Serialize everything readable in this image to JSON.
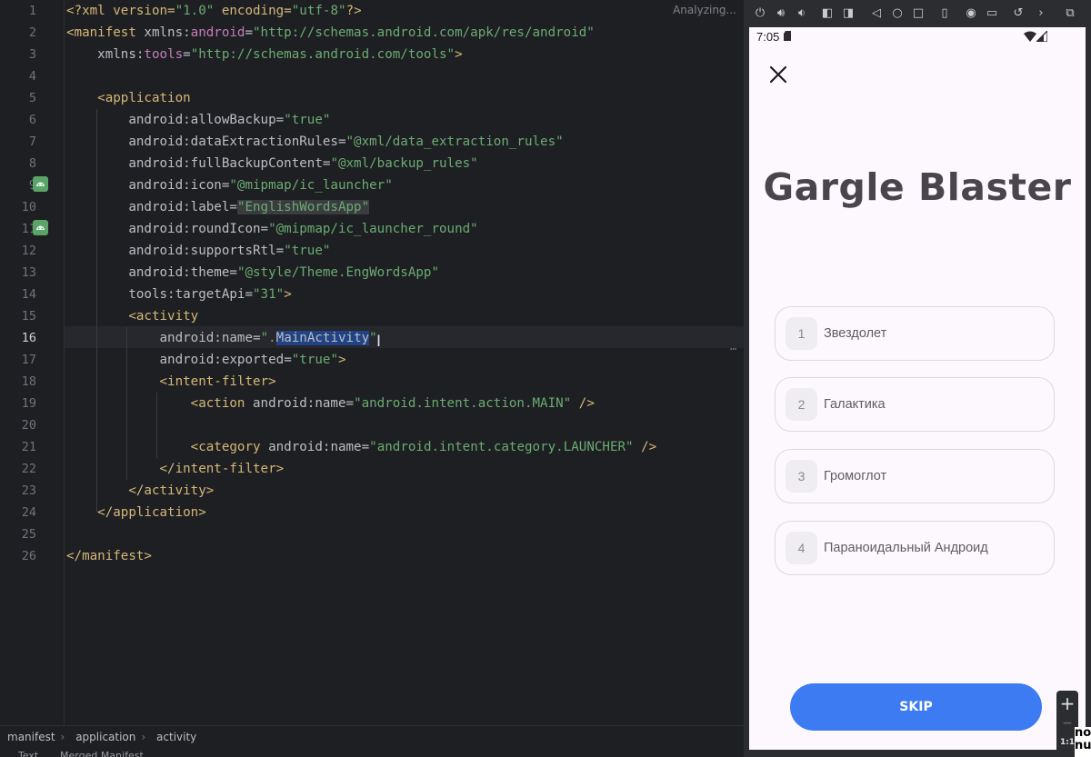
{
  "editor": {
    "status": "Analyzing...",
    "line_numbers": [
      "1",
      "2",
      "3",
      "4",
      "5",
      "6",
      "7",
      "8",
      "9",
      "10",
      "11",
      "12",
      "13",
      "14",
      "15",
      "16",
      "17",
      "18",
      "19",
      "20",
      "21",
      "22",
      "23",
      "24",
      "25",
      "26"
    ],
    "current_line": "16"
  },
  "code": {
    "l1": {
      "a": "<?xml version=",
      "b": "\"1.0\"",
      "c": " encoding=",
      "d": "\"utf-8\"",
      "e": "?>"
    },
    "l2": {
      "a": "<manifest ",
      "b": "xmlns:",
      "c": "android",
      "d": "=",
      "e": "\"http://schemas.android.com/apk/res/android\""
    },
    "l3": {
      "a": "    xmlns:",
      "b": "tools",
      "c": "=",
      "d": "\"http://schemas.android.com/tools\"",
      "e": ">"
    },
    "l5": {
      "a": "    <application"
    },
    "l6": {
      "a": "        android:",
      "b": "allowBackup",
      "c": "=",
      "d": "\"true\""
    },
    "l7": {
      "a": "        android:",
      "b": "dataExtractionRules",
      "c": "=",
      "d": "\"@xml/data_extraction_rules\""
    },
    "l8": {
      "a": "        android:",
      "b": "fullBackupContent",
      "c": "=",
      "d": "\"@xml/backup_rules\""
    },
    "l9": {
      "a": "        android:",
      "b": "icon",
      "c": "=",
      "d": "\"@mipmap/ic_launcher\""
    },
    "l10": {
      "a": "        android:",
      "b": "label",
      "c": "=",
      "d": "\"EnglishWordsApp\""
    },
    "l11": {
      "a": "        android:",
      "b": "roundIcon",
      "c": "=",
      "d": "\"@mipmap/ic_launcher_round\""
    },
    "l12": {
      "a": "        android:",
      "b": "supportsRtl",
      "c": "=",
      "d": "\"true\""
    },
    "l13": {
      "a": "        android:",
      "b": "theme",
      "c": "=",
      "d": "\"@style/Theme.EngWordsApp\""
    },
    "l14": {
      "a": "        tools:",
      "b": "targetApi",
      "c": "=",
      "d": "\"31\"",
      "e": ">"
    },
    "l15": {
      "a": "        <activity"
    },
    "l16": {
      "a": "            android:",
      "b": "name",
      "c": "=",
      "d": "\".",
      "e": "MainActivity",
      "f": "\""
    },
    "l17": {
      "a": "            android:",
      "b": "exported",
      "c": "=",
      "d": "\"true\"",
      "e": ">"
    },
    "l18": {
      "a": "            <intent-filter>"
    },
    "l19": {
      "a": "                <action ",
      "b": "android:",
      "c": "name",
      "d": "=",
      "e": "\"android.intent.action.MAIN\"",
      "f": " />"
    },
    "l21": {
      "a": "                <category ",
      "b": "android:",
      "c": "name",
      "d": "=",
      "e": "\"android.intent.category.LAUNCHER\"",
      "f": " />"
    },
    "l22": {
      "a": "            </intent-filter>"
    },
    "l23": {
      "a": "        </activity>"
    },
    "l24": {
      "a": "    </application>"
    },
    "l26": {
      "a": "</manifest>"
    }
  },
  "breadcrumb": [
    "manifest",
    "application",
    "activity"
  ],
  "bottom_tabs": [
    "Text",
    "Merged Manifest"
  ],
  "emulator": {
    "toolbar_icons": [
      "power-icon",
      "volume-up-icon",
      "volume-down-icon",
      "rotate-left-icon",
      "rotate-right-icon",
      "back-icon",
      "home-icon",
      "overview-icon",
      "fold-icon",
      "screenshot-icon",
      "record-icon",
      "undo-icon",
      "more-icon",
      "device-manager-icon"
    ],
    "status_time": "7:05",
    "title": "Gargle Blaster",
    "options": [
      {
        "num": "1",
        "text": "Звездолет"
      },
      {
        "num": "2",
        "text": "Галактика"
      },
      {
        "num": "3",
        "text": "Громоглот"
      },
      {
        "num": "4",
        "text": "Параноидальный Андроид"
      }
    ],
    "skip_label": "SKIP",
    "zoom": {
      "plus": "+",
      "minus": "−",
      "ratio": "1:1"
    },
    "corner_text": "no\nnu"
  },
  "colors": {
    "accent": "#3d7bf2",
    "editor_bg": "#1e1f22",
    "phone_bg": "#fdf8fd"
  }
}
